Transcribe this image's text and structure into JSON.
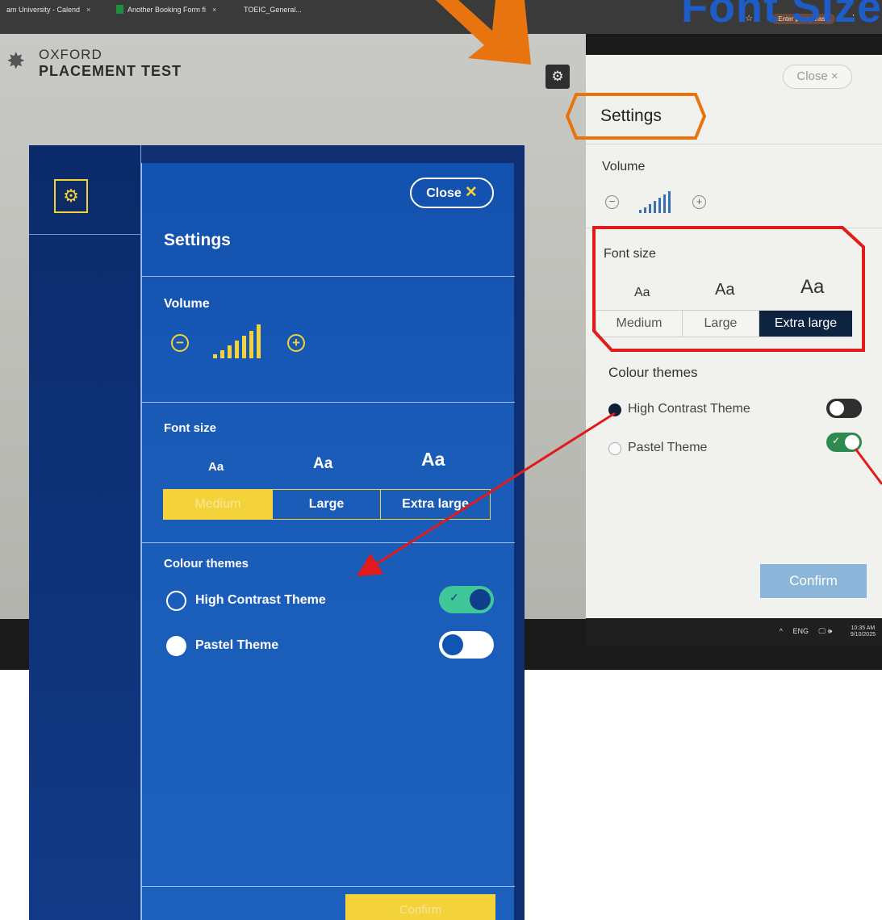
{
  "browser": {
    "tabs": [
      {
        "label": "am University - Calend"
      },
      {
        "label": "Another Booking Form fi"
      },
      {
        "label": "TOEIC_General..."
      }
    ],
    "tab_close": "×",
    "profile_label": "Enter passphrase",
    "star_glyph": "☆",
    "kebab_glyph": "⋮"
  },
  "overlay_heading": "Font Size",
  "app": {
    "logo_line1": "OXFORD",
    "logo_line2": "PLACEMENT TEST",
    "gear_glyph": "⚙"
  },
  "light_panel": {
    "close_label": "Close ×",
    "title": "Settings",
    "volume_label": "Volume",
    "volume_minus": "−",
    "volume_plus": "+",
    "font_size_label": "Font size",
    "aa_sample": "Aa",
    "font_options": [
      "Medium",
      "Large",
      "Extra large"
    ],
    "selected_font": "Extra large",
    "colour_themes_label": "Colour themes",
    "themes": [
      {
        "name": "High Contrast Theme",
        "radio_selected": true,
        "toggle_on": false
      },
      {
        "name": "Pastel Theme",
        "radio_selected": false,
        "toggle_on": true
      }
    ],
    "toggle_check": "✓",
    "confirm_label": "Confirm"
  },
  "taskbar": {
    "caret": "^",
    "lang": "ENG",
    "icons": "🖵 🕪",
    "time": "10:35 AM",
    "date": "9/10/2025"
  },
  "dark_panel": {
    "gear_glyph": "⚙",
    "close_label": "Close",
    "close_x": "✕",
    "title": "Settings",
    "volume_label": "Volume",
    "volume_minus": "−",
    "volume_plus": "+",
    "font_size_label": "Font size",
    "aa_sample": "Aa",
    "font_options": [
      "Medium",
      "Large",
      "Extra large"
    ],
    "selected_font": "Medium",
    "colour_themes_label": "Colour themes",
    "themes": [
      {
        "name": "High Contrast Theme",
        "radio_selected": false,
        "toggle_on": true
      },
      {
        "name": "Pastel Theme",
        "radio_selected": true,
        "toggle_on": false
      }
    ],
    "toggle_check": "✓",
    "confirm_label": "Confirm"
  },
  "colors": {
    "dark_panel_bg": "#1a5cb8",
    "accent_yellow": "#f4d23a",
    "light_selected": "#0e2340",
    "toggle_green": "#2e8a4f",
    "highlight_orange": "#e8740f",
    "highlight_red": "#e11b1b"
  }
}
